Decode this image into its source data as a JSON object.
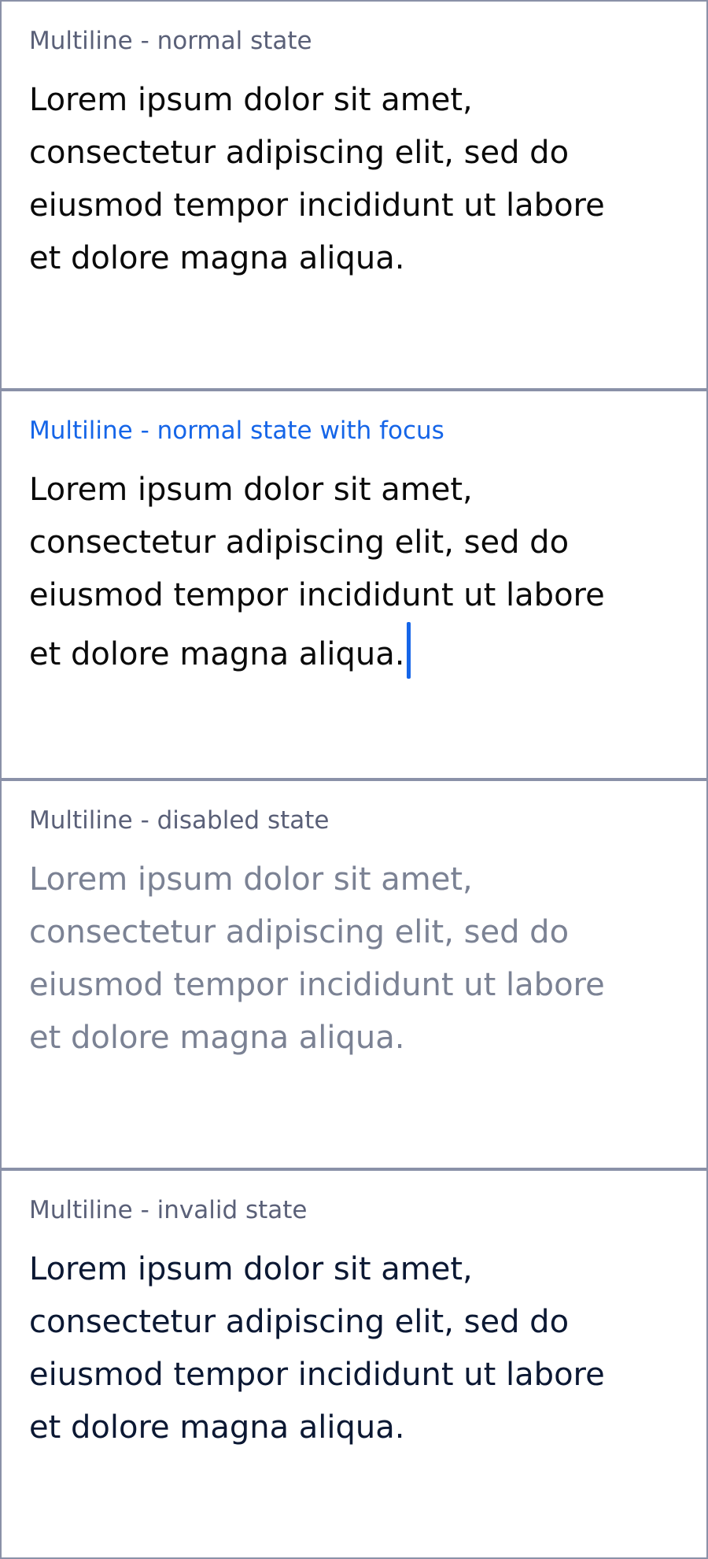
{
  "fields": [
    {
      "label": "Multiline - normal state",
      "state": "normal",
      "lines": [
        "Lorem ipsum dolor sit amet,",
        "consectetur adipiscing elit, sed do",
        "eiusmod tempor incididunt ut labore",
        "et dolore magna aliqua."
      ]
    },
    {
      "label": "Multiline - normal state with focus",
      "state": "focused",
      "lines": [
        "Lorem ipsum dolor sit amet,",
        "consectetur adipiscing elit, sed do",
        "eiusmod tempor incididunt ut labore",
        "et dolore magna aliqua."
      ]
    },
    {
      "label": "Multiline - disabled state",
      "state": "disabled",
      "lines": [
        "Lorem ipsum dolor sit amet,",
        "consectetur adipiscing elit, sed do",
        "eiusmod tempor incididunt ut labore",
        "et dolore magna aliqua."
      ]
    },
    {
      "label": "Multiline - invalid state",
      "state": "invalid",
      "lines": [
        "Lorem ipsum dolor sit amet,",
        "consectetur adipiscing elit, sed do",
        "eiusmod tempor incididunt ut labore",
        "et dolore magna aliqua."
      ]
    }
  ],
  "colors": {
    "border": "#8a91a8",
    "label": "#5a6078",
    "focus_accent": "#1565e8",
    "text": "#0a0a0a",
    "disabled_text": "#7b8294",
    "invalid_text": "#0b1833"
  }
}
